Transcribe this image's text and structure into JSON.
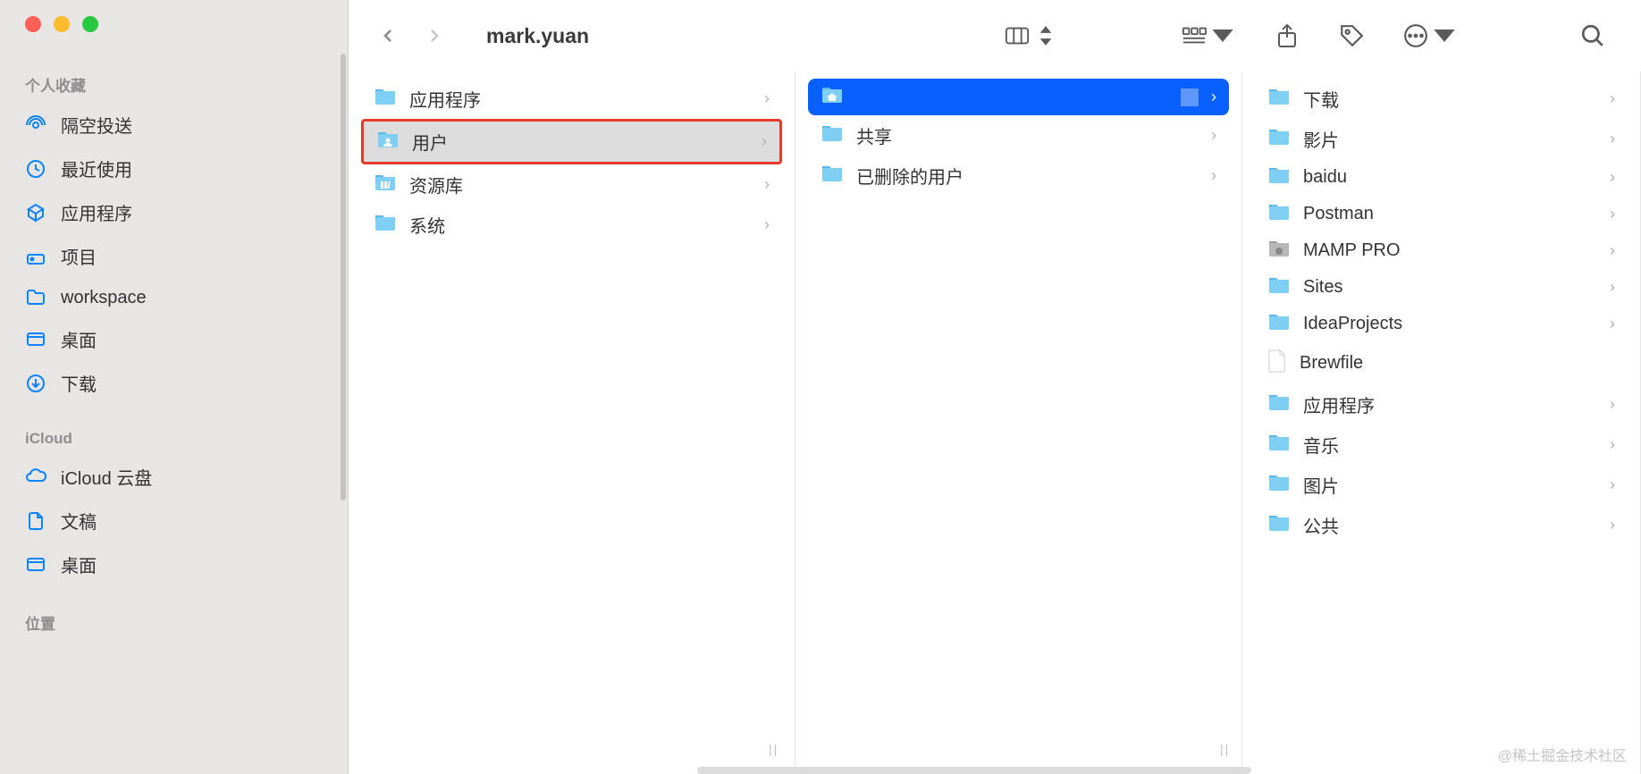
{
  "window_title": "mark.yuan",
  "sidebar": {
    "sections": [
      {
        "title": "个人收藏",
        "items": [
          {
            "icon": "airdrop",
            "label": "隔空投送"
          },
          {
            "icon": "clock",
            "label": "最近使用"
          },
          {
            "icon": "app",
            "label": "应用程序"
          },
          {
            "icon": "stack",
            "label": "项目"
          },
          {
            "icon": "folder",
            "label": "workspace"
          },
          {
            "icon": "desktop",
            "label": "桌面"
          },
          {
            "icon": "download",
            "label": "下载"
          }
        ]
      },
      {
        "title": "iCloud",
        "items": [
          {
            "icon": "cloud",
            "label": "iCloud 云盘"
          },
          {
            "icon": "doc",
            "label": "文稿"
          },
          {
            "icon": "desktop",
            "label": "桌面"
          }
        ]
      },
      {
        "title": "位置",
        "items": []
      }
    ]
  },
  "columns": [
    {
      "items": [
        {
          "type": "folder",
          "label": "应用程序",
          "has_chevron": true
        },
        {
          "type": "folder-user",
          "label": "用户",
          "has_chevron": true,
          "selected": "grey",
          "highlighted": true
        },
        {
          "type": "folder-lib",
          "label": "资源库",
          "has_chevron": true
        },
        {
          "type": "folder",
          "label": "系统",
          "has_chevron": true
        }
      ]
    },
    {
      "items": [
        {
          "type": "folder-home",
          "label": "",
          "has_chevron": true,
          "selected": "blue"
        },
        {
          "type": "folder",
          "label": "共享",
          "has_chevron": true
        },
        {
          "type": "folder",
          "label": "已删除的用户",
          "has_chevron": true
        }
      ]
    },
    {
      "items": [
        {
          "type": "folder",
          "label": "下载",
          "has_chevron": true
        },
        {
          "type": "folder",
          "label": "影片",
          "has_chevron": true
        },
        {
          "type": "folder",
          "label": "baidu",
          "has_chevron": true
        },
        {
          "type": "folder",
          "label": "Postman",
          "has_chevron": true
        },
        {
          "type": "folder-app",
          "label": "MAMP PRO",
          "has_chevron": true
        },
        {
          "type": "folder",
          "label": "Sites",
          "has_chevron": true
        },
        {
          "type": "folder",
          "label": "IdeaProjects",
          "has_chevron": true
        },
        {
          "type": "file",
          "label": "Brewfile",
          "has_chevron": false
        },
        {
          "type": "folder",
          "label": "应用程序",
          "has_chevron": true
        },
        {
          "type": "folder",
          "label": "音乐",
          "has_chevron": true
        },
        {
          "type": "folder",
          "label": "图片",
          "has_chevron": true
        },
        {
          "type": "folder",
          "label": "公共",
          "has_chevron": true
        }
      ]
    }
  ],
  "watermark": "@稀土掘金技术社区"
}
